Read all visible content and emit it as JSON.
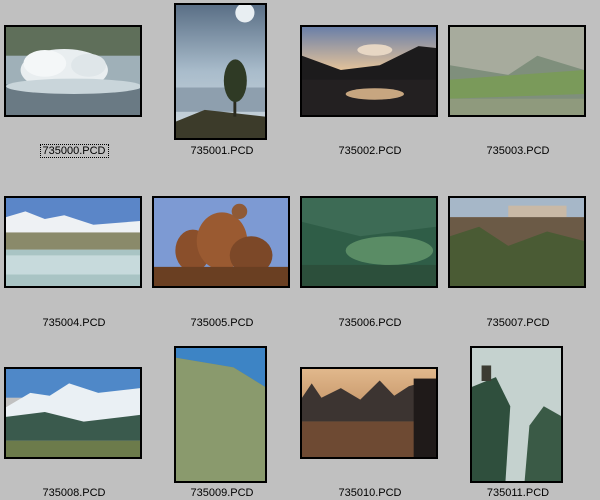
{
  "files": [
    {
      "name": "735000.PCD",
      "selected": true
    },
    {
      "name": "735001.PCD"
    },
    {
      "name": "735002.PCD"
    },
    {
      "name": "735003.PCD"
    },
    {
      "name": "735004.PCD"
    },
    {
      "name": "735005.PCD"
    },
    {
      "name": "735006.PCD"
    },
    {
      "name": "735007.PCD"
    },
    {
      "name": "735008.PCD"
    },
    {
      "name": "735009.PCD"
    },
    {
      "name": "735010.PCD"
    },
    {
      "name": "735011.PCD"
    }
  ],
  "colors": {
    "background": "#c0c0c0",
    "frame": "#000000"
  }
}
